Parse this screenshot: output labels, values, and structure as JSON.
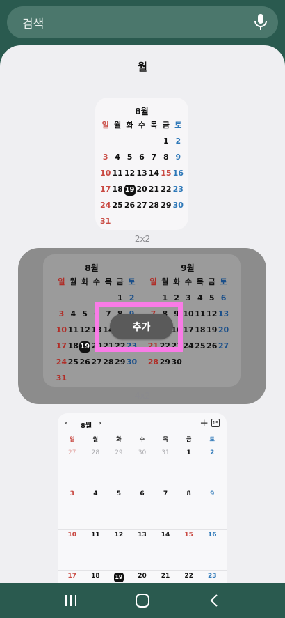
{
  "search": {
    "label": "검색",
    "icon": "mic-icon"
  },
  "sheet": {
    "title": "월"
  },
  "weekdays": [
    "일",
    "월",
    "화",
    "수",
    "목",
    "금",
    "토"
  ],
  "aug": {
    "title": "8월",
    "weeks": [
      [
        "",
        "",
        "",
        "",
        "",
        "1",
        "2"
      ],
      [
        "3",
        "4",
        "5",
        "6",
        "7",
        "8",
        "9"
      ],
      [
        "10",
        "11",
        "12",
        "13",
        "14",
        "15",
        "16"
      ],
      [
        "17",
        "18",
        "19",
        "20",
        "21",
        "22",
        "23"
      ],
      [
        "24",
        "25",
        "26",
        "27",
        "28",
        "29",
        "30"
      ],
      [
        "31",
        "",
        "",
        "",
        "",
        "",
        ""
      ]
    ],
    "today": "19",
    "holiday": "15"
  },
  "sep": {
    "title": "9월",
    "weeks": [
      [
        "",
        "1",
        "2",
        "3",
        "4",
        "5",
        "6"
      ],
      [
        "7",
        "8",
        "9",
        "10",
        "11",
        "12",
        "13"
      ],
      [
        "14",
        "15",
        "16",
        "17",
        "18",
        "19",
        "20"
      ],
      [
        "21",
        "22",
        "23",
        "24",
        "25",
        "26",
        "27"
      ],
      [
        "28",
        "29",
        "30",
        "",
        "",
        "",
        ""
      ]
    ]
  },
  "widgets": {
    "small_size": "2x2",
    "wide_size": "4x2",
    "add_label": "추가"
  },
  "month_widget": {
    "month": "8월",
    "today_box": "19",
    "rows": [
      [
        "27",
        "28",
        "29",
        "30",
        "31",
        "1",
        "2"
      ],
      [
        "3",
        "4",
        "5",
        "6",
        "7",
        "8",
        "9"
      ],
      [
        "10",
        "11",
        "12",
        "13",
        "14",
        "15",
        "16"
      ],
      [
        "17",
        "18",
        "19",
        "20",
        "21",
        "22",
        "23"
      ]
    ]
  },
  "colors": {
    "sunday": "#c94a43",
    "saturday": "#2e78b8",
    "highlight": "#f97be7",
    "background": "#2a5a4f"
  }
}
